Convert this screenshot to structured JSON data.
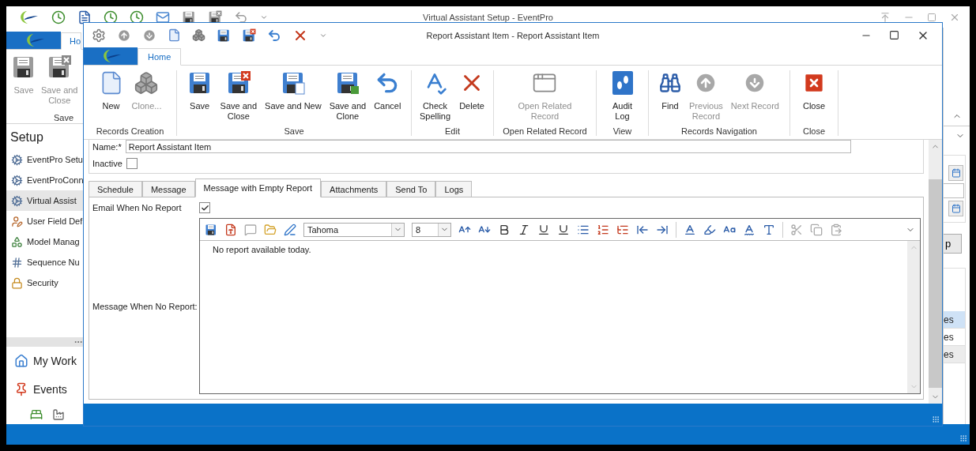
{
  "background_window": {
    "title": "Virtual Assistant Setup - EventPro",
    "ribbon_tab": {
      "label": "Ho",
      "selected": true
    },
    "ribbon_buttons": [
      {
        "lines": [
          "Save"
        ],
        "disabled": true
      },
      {
        "lines": [
          "Save and",
          "Close"
        ],
        "disabled": true
      }
    ],
    "ribbon_group": "Save",
    "nav_header": "Setup",
    "nav_items": [
      {
        "label": "EventPro Setu",
        "selected": false
      },
      {
        "label": "EventProConn",
        "selected": false
      },
      {
        "label": "Virtual Assist",
        "selected": true
      },
      {
        "label": "User Field Def",
        "selected": false
      },
      {
        "label": "Model Manag",
        "selected": false
      },
      {
        "label": "Sequence Nu",
        "selected": false
      },
      {
        "label": "Security",
        "selected": false
      }
    ],
    "panes": [
      "My Work",
      "Events"
    ],
    "side_button": "p",
    "grid_rows": [
      {
        "text": "es",
        "selected": true
      },
      {
        "text": "es",
        "selected": false
      },
      {
        "text": "es",
        "selected": false
      }
    ]
  },
  "dialog": {
    "title": "Report Assistant Item - Report Assistant Item",
    "ribbon_tab": {
      "label": "Home",
      "selected": true
    },
    "ribbon_groups": [
      {
        "label": "Records Creation",
        "buttons": [
          {
            "lines": [
              "New"
            ],
            "disabled": false
          },
          {
            "lines": [
              "Clone..."
            ],
            "disabled": true
          }
        ]
      },
      {
        "label": "Save",
        "buttons": [
          {
            "lines": [
              "Save"
            ],
            "disabled": false
          },
          {
            "lines": [
              "Save and",
              "Close"
            ],
            "disabled": false
          },
          {
            "lines": [
              "Save and New"
            ],
            "disabled": false
          },
          {
            "lines": [
              "Save and",
              "Clone"
            ],
            "disabled": false
          },
          {
            "lines": [
              "Cancel"
            ],
            "disabled": false
          }
        ]
      },
      {
        "label": "Edit",
        "buttons": [
          {
            "lines": [
              "Check",
              "Spelling"
            ],
            "disabled": false
          },
          {
            "lines": [
              "Delete"
            ],
            "disabled": false
          }
        ]
      },
      {
        "label": "Open Related Record",
        "buttons": [
          {
            "lines": [
              "Open Related",
              "Record"
            ],
            "disabled": true
          }
        ]
      },
      {
        "label": "View",
        "buttons": [
          {
            "lines": [
              "Audit",
              "Log"
            ],
            "disabled": false
          }
        ]
      },
      {
        "label": "Records Navigation",
        "buttons": [
          {
            "lines": [
              "Find"
            ],
            "disabled": false
          },
          {
            "lines": [
              "Previous",
              "Record"
            ],
            "disabled": true
          },
          {
            "lines": [
              "Next Record"
            ],
            "disabled": true
          }
        ]
      },
      {
        "label": "Close",
        "buttons": [
          {
            "lines": [
              "Close"
            ],
            "disabled": false
          }
        ]
      }
    ],
    "name_label": "Name:*",
    "name_value": "Report Assistant Item",
    "inactive": {
      "label": "Inactive",
      "checked": false
    },
    "tabs": [
      {
        "label": "Schedule",
        "selected": false
      },
      {
        "label": "Message",
        "selected": false
      },
      {
        "label": "Message with Empty Report",
        "selected": true
      },
      {
        "label": "Attachments",
        "selected": false
      },
      {
        "label": "Send To",
        "selected": false
      },
      {
        "label": "Logs",
        "selected": false
      }
    ],
    "email_when_no_report": {
      "label": "Email When No Report",
      "checked": true
    },
    "message_label": "Message When No Report:",
    "editor": {
      "font": "Tahoma",
      "size": "8",
      "text": "No report available today."
    }
  }
}
